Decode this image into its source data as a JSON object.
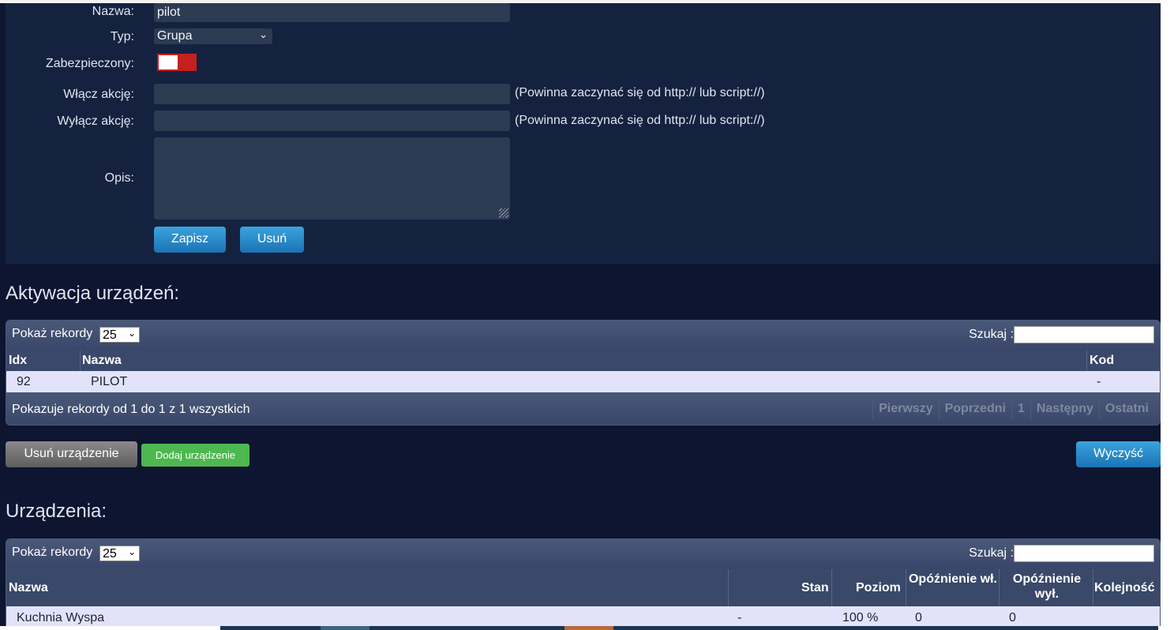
{
  "form": {
    "name_label": "Nazwa:",
    "name_value": "pilot",
    "type_label": "Typ:",
    "type_value": "Grupa",
    "secured_label": "Zabezpieczony:",
    "on_action_label": "Włącz akcję:",
    "on_action_value": "",
    "on_action_hint": "(Powinna zaczynać się od http:// lub script://)",
    "off_action_label": "Wyłącz akcję:",
    "off_action_value": "",
    "off_action_hint": "(Powinna zaczynać się od http:// lub script://)",
    "description_label": "Opis:",
    "save_button": "Zapisz",
    "delete_button": "Usuń"
  },
  "activation": {
    "title": "Aktywacja urządzeń:",
    "show_label": "Pokaż rekordy",
    "page_size": "25",
    "search_label": "Szukaj :",
    "columns": [
      "Idx",
      "Nazwa",
      "Kod"
    ],
    "rows": [
      {
        "idx": "92",
        "name": "PILOT",
        "code": "-"
      }
    ],
    "info": "Pokazuje rekordy od 1 do 1 z 1 wszystkich",
    "pager": {
      "first": "Pierwszy",
      "prev": "Poprzedni",
      "page": "1",
      "next": "Następny",
      "last": "Ostatni"
    },
    "remove_device_button": "Usuń urządzenie",
    "add_device_button": "Dodaj urządzenie",
    "clear_button": "Wyczyść"
  },
  "devices": {
    "title": "Urządzenia:",
    "show_label": "Pokaż rekordy",
    "page_size": "25",
    "search_label": "Szukaj :",
    "columns": {
      "name": "Nazwa",
      "state": "Stan",
      "level": "Poziom",
      "delay_on": "Opóźnienie wł.",
      "delay_off": "Opóźnienie wył.",
      "order": "Kolejność"
    },
    "rows": [
      {
        "name": "Kuchnia Wyspa",
        "state": "-",
        "level": "100 %",
        "delay_on": "0",
        "delay_off": "0",
        "order": ""
      }
    ]
  },
  "colors": {
    "background": "#0d1530",
    "panel": "#15223f",
    "input": "#2c3a52",
    "toggle_off": "#c4201f",
    "button_blue": "#1c73b5",
    "button_green": "#4db84f",
    "row_light": "#e2e3fa"
  }
}
